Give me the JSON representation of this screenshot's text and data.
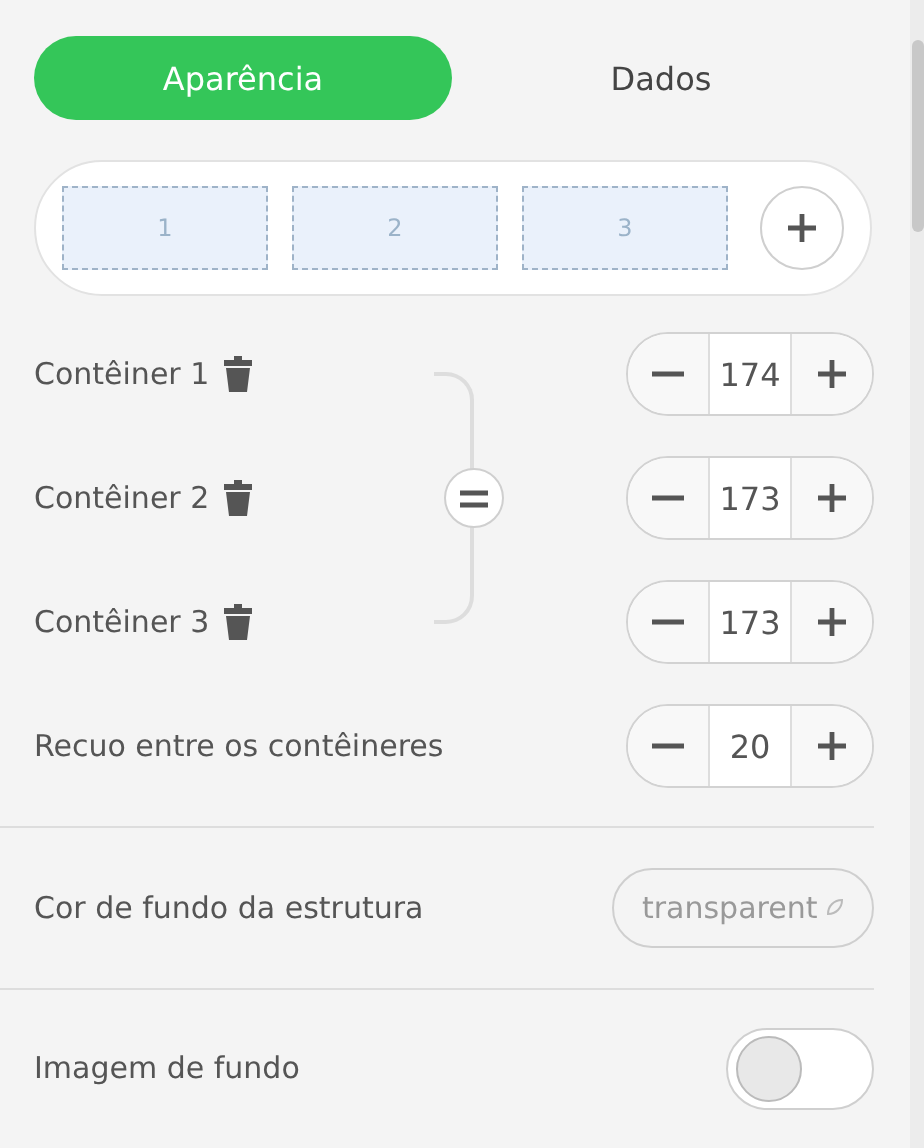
{
  "tabs": [
    {
      "label": "Aparência",
      "selected": true
    },
    {
      "label": "Dados",
      "selected": false
    }
  ],
  "layout_preview": {
    "boxes": [
      "1",
      "2",
      "3"
    ]
  },
  "containers": [
    {
      "label": "Contêiner 1",
      "value": "174"
    },
    {
      "label": "Contêiner 2",
      "value": "173"
    },
    {
      "label": "Contêiner 3",
      "value": "173"
    }
  ],
  "gap": {
    "label": "Recuo entre os contêineres",
    "value": "20"
  },
  "background_color": {
    "label": "Cor de fundo da estrutura",
    "value": "transparent"
  },
  "background_image": {
    "label": "Imagem de fundo",
    "on": false
  }
}
